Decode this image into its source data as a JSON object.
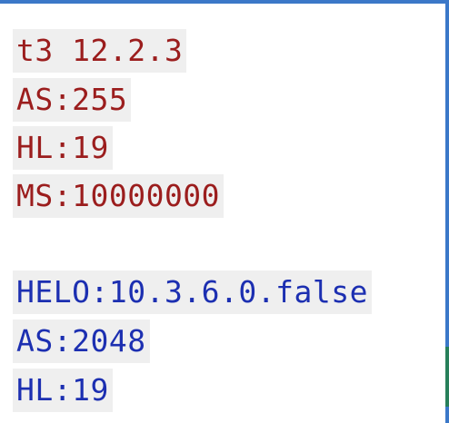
{
  "response_1": {
    "line_1": "t3 12.2.3",
    "line_2": "AS:255",
    "line_3": "HL:19",
    "line_4": "MS:10000000"
  },
  "response_2": {
    "line_1": "HELO:10.3.6.0.false",
    "line_2": "AS:2048",
    "line_3": "HL:19"
  },
  "colors": {
    "response_1_text": "#9b1d1d",
    "response_2_text": "#1c2fb1",
    "line_background": "#efefef",
    "border": "#3b78c8"
  }
}
